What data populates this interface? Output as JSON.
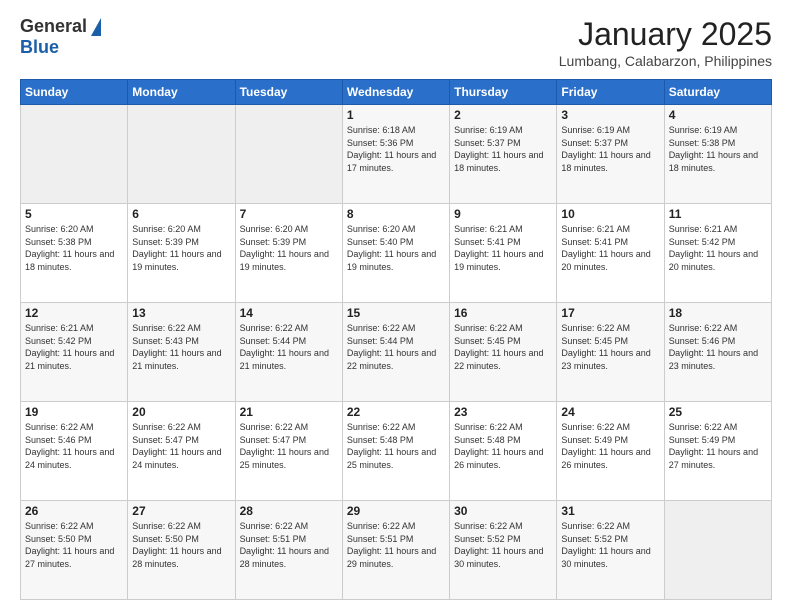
{
  "header": {
    "logo_general": "General",
    "logo_blue": "Blue",
    "month_title": "January 2025",
    "subtitle": "Lumbang, Calabarzon, Philippines"
  },
  "calendar": {
    "days_of_week": [
      "Sunday",
      "Monday",
      "Tuesday",
      "Wednesday",
      "Thursday",
      "Friday",
      "Saturday"
    ],
    "weeks": [
      [
        {
          "day": "",
          "text": ""
        },
        {
          "day": "",
          "text": ""
        },
        {
          "day": "",
          "text": ""
        },
        {
          "day": "1",
          "text": "Sunrise: 6:18 AM\nSunset: 5:36 PM\nDaylight: 11 hours\nand 17 minutes."
        },
        {
          "day": "2",
          "text": "Sunrise: 6:19 AM\nSunset: 5:37 PM\nDaylight: 11 hours\nand 18 minutes."
        },
        {
          "day": "3",
          "text": "Sunrise: 6:19 AM\nSunset: 5:37 PM\nDaylight: 11 hours\nand 18 minutes."
        },
        {
          "day": "4",
          "text": "Sunrise: 6:19 AM\nSunset: 5:38 PM\nDaylight: 11 hours\nand 18 minutes."
        }
      ],
      [
        {
          "day": "5",
          "text": "Sunrise: 6:20 AM\nSunset: 5:38 PM\nDaylight: 11 hours\nand 18 minutes."
        },
        {
          "day": "6",
          "text": "Sunrise: 6:20 AM\nSunset: 5:39 PM\nDaylight: 11 hours\nand 19 minutes."
        },
        {
          "day": "7",
          "text": "Sunrise: 6:20 AM\nSunset: 5:39 PM\nDaylight: 11 hours\nand 19 minutes."
        },
        {
          "day": "8",
          "text": "Sunrise: 6:20 AM\nSunset: 5:40 PM\nDaylight: 11 hours\nand 19 minutes."
        },
        {
          "day": "9",
          "text": "Sunrise: 6:21 AM\nSunset: 5:41 PM\nDaylight: 11 hours\nand 19 minutes."
        },
        {
          "day": "10",
          "text": "Sunrise: 6:21 AM\nSunset: 5:41 PM\nDaylight: 11 hours\nand 20 minutes."
        },
        {
          "day": "11",
          "text": "Sunrise: 6:21 AM\nSunset: 5:42 PM\nDaylight: 11 hours\nand 20 minutes."
        }
      ],
      [
        {
          "day": "12",
          "text": "Sunrise: 6:21 AM\nSunset: 5:42 PM\nDaylight: 11 hours\nand 21 minutes."
        },
        {
          "day": "13",
          "text": "Sunrise: 6:22 AM\nSunset: 5:43 PM\nDaylight: 11 hours\nand 21 minutes."
        },
        {
          "day": "14",
          "text": "Sunrise: 6:22 AM\nSunset: 5:44 PM\nDaylight: 11 hours\nand 21 minutes."
        },
        {
          "day": "15",
          "text": "Sunrise: 6:22 AM\nSunset: 5:44 PM\nDaylight: 11 hours\nand 22 minutes."
        },
        {
          "day": "16",
          "text": "Sunrise: 6:22 AM\nSunset: 5:45 PM\nDaylight: 11 hours\nand 22 minutes."
        },
        {
          "day": "17",
          "text": "Sunrise: 6:22 AM\nSunset: 5:45 PM\nDaylight: 11 hours\nand 23 minutes."
        },
        {
          "day": "18",
          "text": "Sunrise: 6:22 AM\nSunset: 5:46 PM\nDaylight: 11 hours\nand 23 minutes."
        }
      ],
      [
        {
          "day": "19",
          "text": "Sunrise: 6:22 AM\nSunset: 5:46 PM\nDaylight: 11 hours\nand 24 minutes."
        },
        {
          "day": "20",
          "text": "Sunrise: 6:22 AM\nSunset: 5:47 PM\nDaylight: 11 hours\nand 24 minutes."
        },
        {
          "day": "21",
          "text": "Sunrise: 6:22 AM\nSunset: 5:47 PM\nDaylight: 11 hours\nand 25 minutes."
        },
        {
          "day": "22",
          "text": "Sunrise: 6:22 AM\nSunset: 5:48 PM\nDaylight: 11 hours\nand 25 minutes."
        },
        {
          "day": "23",
          "text": "Sunrise: 6:22 AM\nSunset: 5:48 PM\nDaylight: 11 hours\nand 26 minutes."
        },
        {
          "day": "24",
          "text": "Sunrise: 6:22 AM\nSunset: 5:49 PM\nDaylight: 11 hours\nand 26 minutes."
        },
        {
          "day": "25",
          "text": "Sunrise: 6:22 AM\nSunset: 5:49 PM\nDaylight: 11 hours\nand 27 minutes."
        }
      ],
      [
        {
          "day": "26",
          "text": "Sunrise: 6:22 AM\nSunset: 5:50 PM\nDaylight: 11 hours\nand 27 minutes."
        },
        {
          "day": "27",
          "text": "Sunrise: 6:22 AM\nSunset: 5:50 PM\nDaylight: 11 hours\nand 28 minutes."
        },
        {
          "day": "28",
          "text": "Sunrise: 6:22 AM\nSunset: 5:51 PM\nDaylight: 11 hours\nand 28 minutes."
        },
        {
          "day": "29",
          "text": "Sunrise: 6:22 AM\nSunset: 5:51 PM\nDaylight: 11 hours\nand 29 minutes."
        },
        {
          "day": "30",
          "text": "Sunrise: 6:22 AM\nSunset: 5:52 PM\nDaylight: 11 hours\nand 30 minutes."
        },
        {
          "day": "31",
          "text": "Sunrise: 6:22 AM\nSunset: 5:52 PM\nDaylight: 11 hours\nand 30 minutes."
        },
        {
          "day": "",
          "text": ""
        }
      ]
    ]
  }
}
